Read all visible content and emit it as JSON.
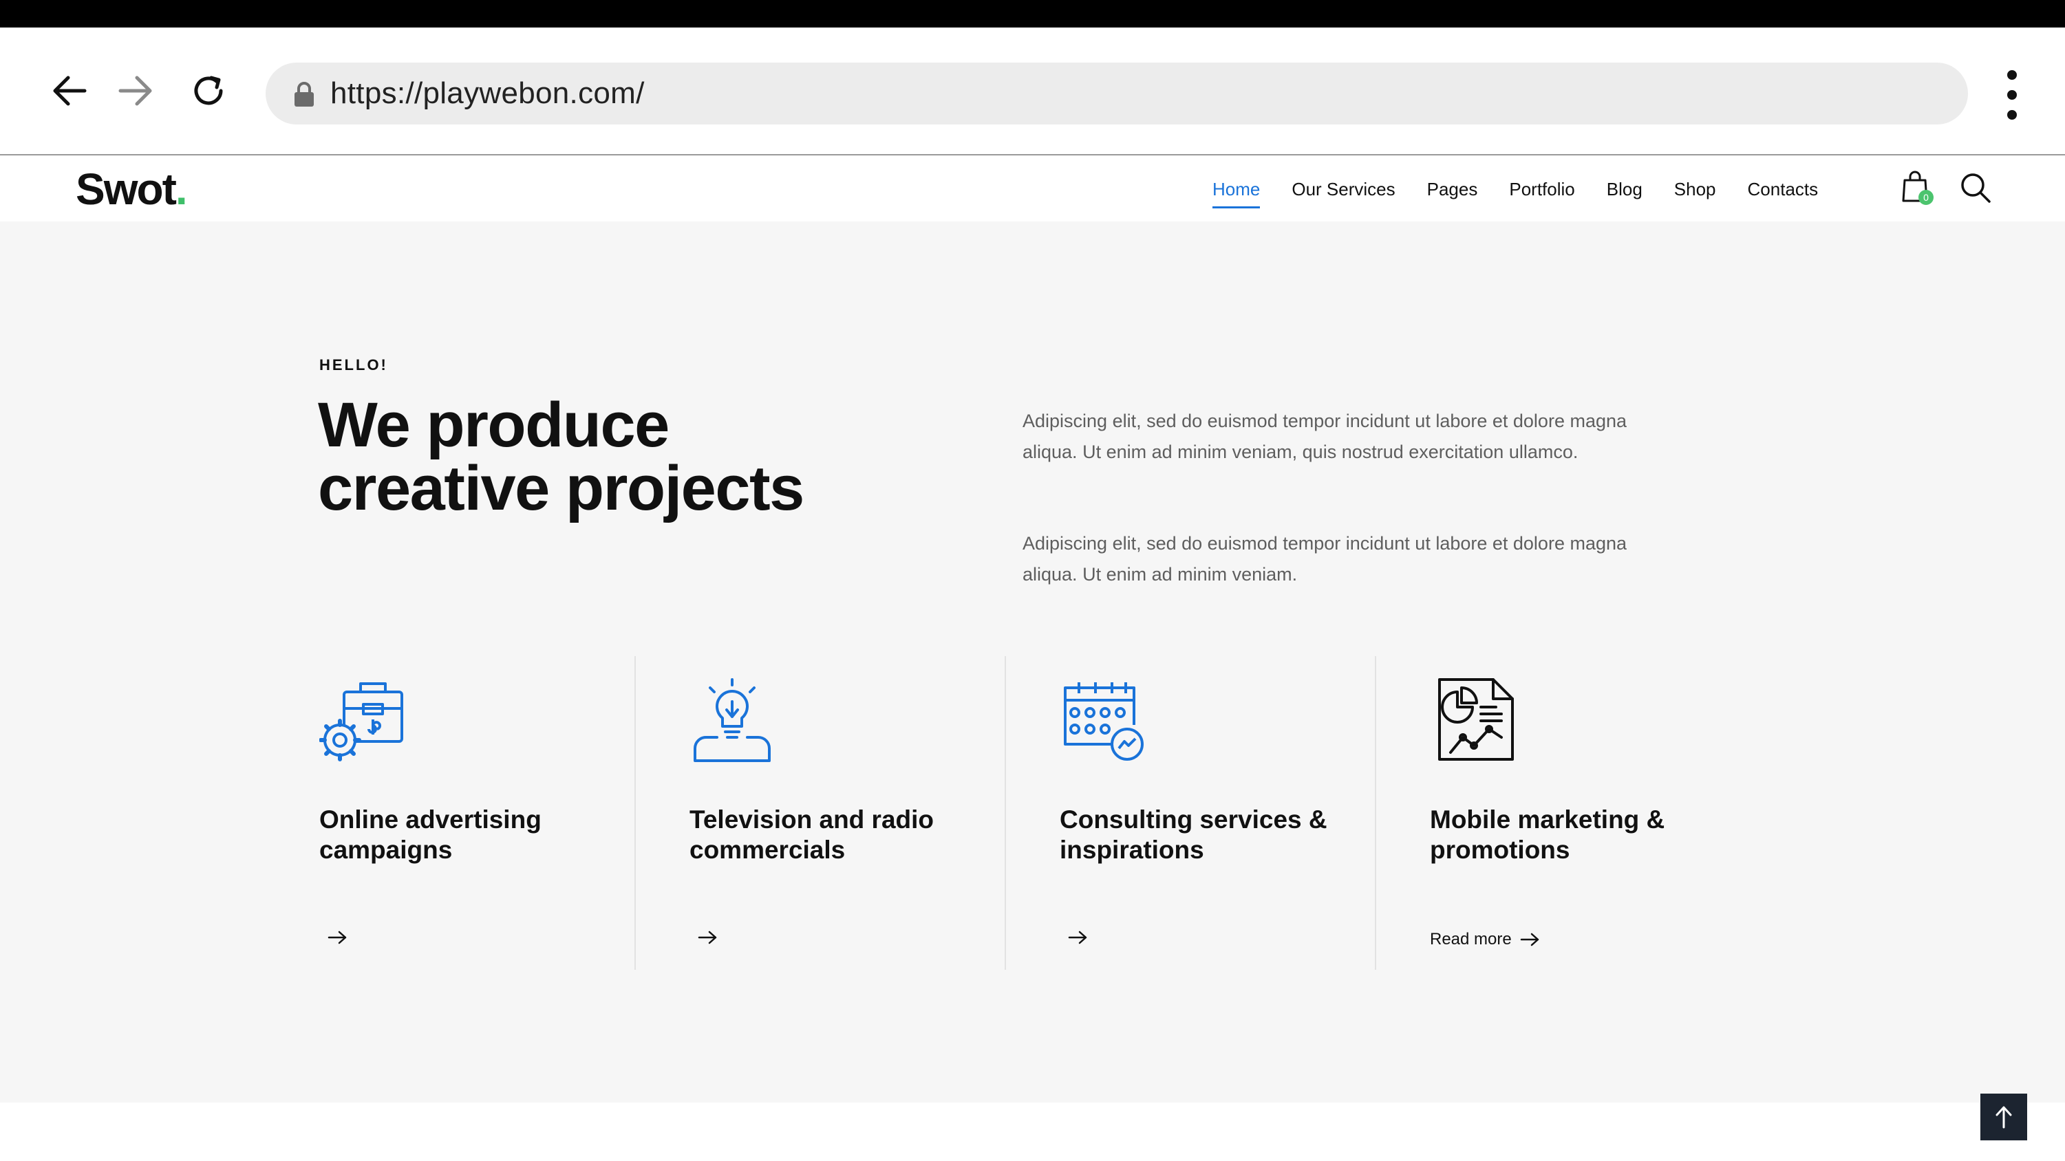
{
  "browser": {
    "url": "https://playwebon.com/",
    "icons": [
      "back-arrow-icon",
      "forward-arrow-icon",
      "reload-icon",
      "lock-icon",
      "kebab-menu-icon"
    ]
  },
  "site": {
    "logo_text": "Swot",
    "logo_dot": ".",
    "logo_dot_color": "#3fbf6a",
    "accent_color": "#1a73d9",
    "nav": [
      {
        "label": "Home",
        "active": true
      },
      {
        "label": "Our Services",
        "active": false
      },
      {
        "label": "Pages",
        "active": false
      },
      {
        "label": "Portfolio",
        "active": false
      },
      {
        "label": "Blog",
        "active": false
      },
      {
        "label": "Shop",
        "active": false
      },
      {
        "label": "Contacts",
        "active": false
      }
    ],
    "cart_count": "0",
    "header_icons": [
      "shopping-bag-icon",
      "search-icon"
    ]
  },
  "hero": {
    "eyebrow": "HELLO!",
    "headline_line1": "We produce",
    "headline_line2": "creative projects",
    "paragraph1": "Adipiscing elit, sed do euismod tempor incidunt ut labore et dolore magna aliqua. Ut enim ad minim veniam, quis nostrud exercitation ullamco.",
    "paragraph2": "Adipiscing elit, sed do euismod tempor incidunt ut labore et dolore magna aliqua. Ut enim ad minim veniam."
  },
  "services": [
    {
      "title": "Online advertising campaigns",
      "icon": "briefcase-gear-icon",
      "link_label": ""
    },
    {
      "title": "Television and radio commercials",
      "icon": "lightbulb-person-icon",
      "link_label": ""
    },
    {
      "title": "Consulting services & inspirations",
      "icon": "calendar-chart-icon",
      "link_label": ""
    },
    {
      "title": "Mobile marketing & promotions",
      "icon": "report-chart-icon",
      "link_label": "Read more"
    }
  ],
  "scroll_top_icon": "arrow-up-icon"
}
